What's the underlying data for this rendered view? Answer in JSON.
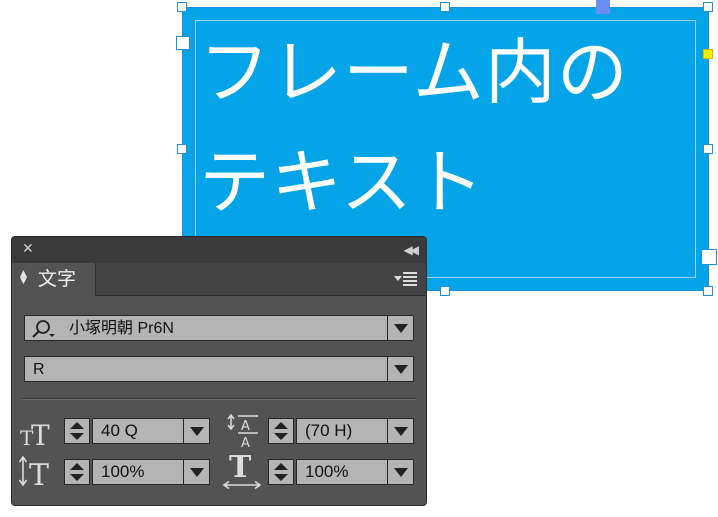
{
  "frame": {
    "text": "フレーム内のテキスト",
    "fill_color": "#05a3e8"
  },
  "panel": {
    "tab_label": "文字",
    "icons": {
      "close": "close-icon",
      "collapse": "double-chevron-left-icon",
      "menu": "panel-menu-icon",
      "search": "search-icon"
    },
    "font_family": "小塚明朝 Pr6N",
    "font_style": "R",
    "font_size": "40 Q",
    "leading": "(70 H)",
    "vertical_scale": "100%",
    "horizontal_scale": "100%"
  }
}
